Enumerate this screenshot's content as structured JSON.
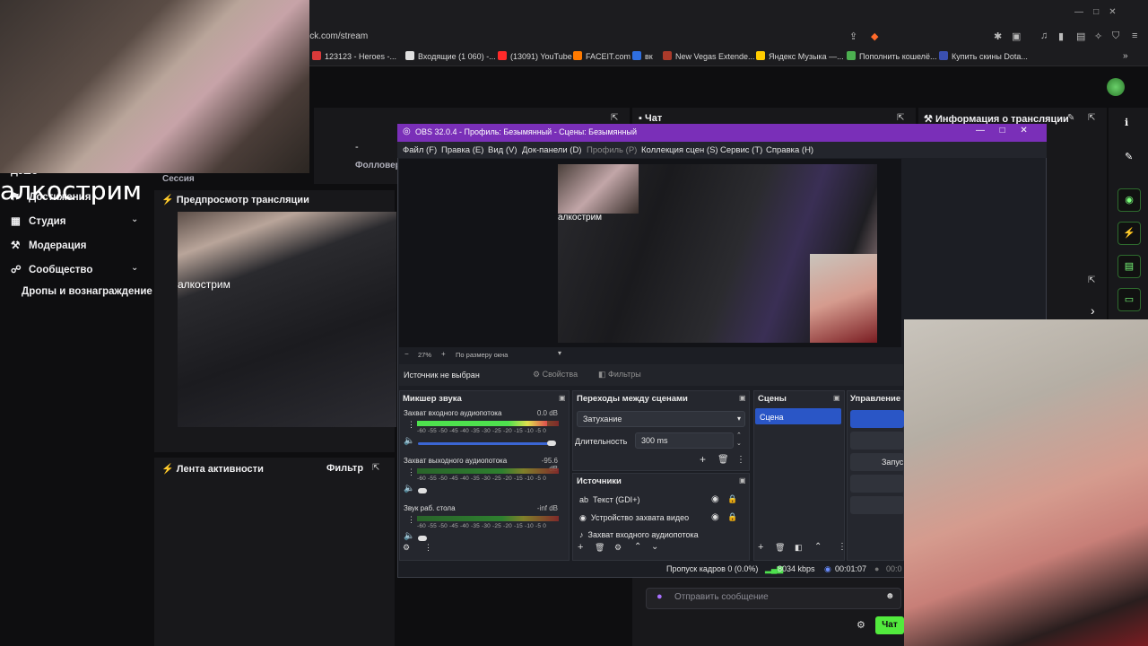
{
  "browser": {
    "url": "ick.com/stream",
    "bookmarks": [
      {
        "label": "123123 - Heroes -...",
        "color": "#d93a3a"
      },
      {
        "label": "Входящие (1 060) -...",
        "color": "#e0e0e0"
      },
      {
        "label": "(13091) YouTube",
        "color": "#ff2a2a"
      },
      {
        "label": "FACEIT.com",
        "color": "#ff7a00"
      },
      {
        "label": "вк",
        "color": "#2f6fe0"
      },
      {
        "label": "New Vegas Extende...",
        "color": "#aa3a2a"
      },
      {
        "label": "Яндекс Музыка —...",
        "color": "#ffcc00"
      },
      {
        "label": "Пополнить кошелё...",
        "color": "#4caf50"
      },
      {
        "label": "Купить скины Dota...",
        "color": "#3a4fb0"
      }
    ]
  },
  "dashboard": {
    "overlay_text": "алкострим",
    "session_label": "Сессия",
    "followers_label": "Фолловер",
    "dash_value": "-",
    "sidebar": [
      {
        "label": "Достижения",
        "icon": "trophy-icon"
      },
      {
        "label": "Студия",
        "icon": "studio-icon",
        "expandable": true
      },
      {
        "label": "Модерация",
        "icon": "wrench-icon"
      },
      {
        "label": "Сообщество",
        "icon": "community-icon",
        "expandable": true
      },
      {
        "label": "Дропы и вознаграждение",
        "icon": ""
      }
    ],
    "sidebar_top": "Дэшб",
    "preview_title": "Предпросмотр трансляции",
    "activity_title": "Лента активности",
    "activity_filter": "Фильтр",
    "chat_title": "Чат",
    "info_title": "Информация о трансляции",
    "chat_placeholder": "Отправить сообщение",
    "chat_button": "Чат"
  },
  "obs": {
    "title": "OBS 32.0.4 - Профиль: Безымянный - Сцены: Безымянный",
    "menu": [
      "Файл (F)",
      "Правка (E)",
      "Вид (V)",
      "Док-панели (D)",
      "Профиль (P)",
      "Коллекция сцен (S)",
      "Сервис (T)",
      "Справка (H)"
    ],
    "zoom": "27%",
    "fit": "По размеру окна",
    "no_source": "Источник не выбран",
    "properties": "Свойства",
    "filters": "Фильтры",
    "mixer": {
      "title": "Микшер звука",
      "channels": [
        {
          "name": "Захват входного аудиопотока",
          "db": "0.0 dB",
          "level": 0.92
        },
        {
          "name": "Захват выходного аудиопотока",
          "db": "-95.6 dB",
          "level": 0.0
        },
        {
          "name": "Звук раб. стола",
          "db": "-inf dB",
          "level": 0.0
        }
      ],
      "scale": "-60 -55 -50 -45 -40 -35 -30 -25 -20 -15 -10 -5 0"
    },
    "transitions": {
      "title": "Переходы между сценами",
      "selected": "Затухание",
      "duration_label": "Длительность",
      "duration_value": "300 ms"
    },
    "scenes": {
      "title": "Сцены",
      "items": [
        "Сцена"
      ]
    },
    "controls": {
      "title": "Управление",
      "partial": "Запус"
    },
    "sources": {
      "title": "Источники",
      "items": [
        "Текст (GDI+)",
        "Устройство захвата видео",
        "Захват входного аудиопотока"
      ]
    },
    "status": {
      "dropped": "Пропуск кадров 0 (0.0%)",
      "bitrate": "8034 kbps",
      "time": "00:01:07",
      "time2": "00:0"
    }
  }
}
